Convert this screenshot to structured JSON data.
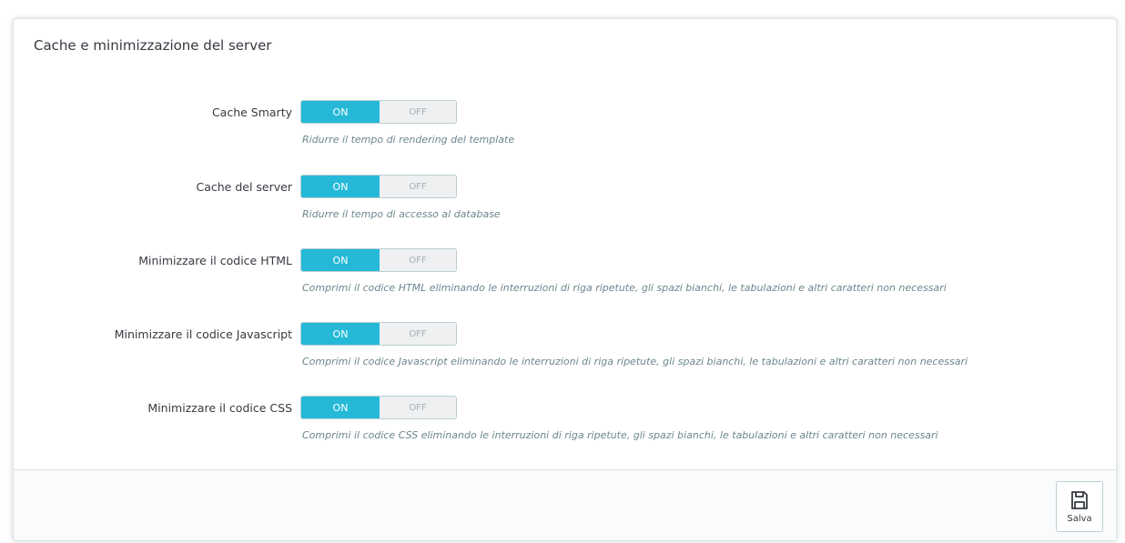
{
  "panel": {
    "title": "Cache e minimizzazione del server"
  },
  "settings": [
    {
      "label": "Cache Smarty",
      "on_label": "ON",
      "off_label": "OFF",
      "value": "ON",
      "help": "Ridurre il tempo di rendering del template"
    },
    {
      "label": "Cache del server",
      "on_label": "ON",
      "off_label": "OFF",
      "value": "ON",
      "help": "Ridurre il tempo di accesso al database"
    },
    {
      "label": "Minimizzare il codice HTML",
      "on_label": "ON",
      "off_label": "OFF",
      "value": "ON",
      "help": "Comprimi il codice HTML eliminando le interruzioni di riga ripetute, gli spazi bianchi, le tabulazioni e altri caratteri non necessari"
    },
    {
      "label": "Minimizzare il codice Javascript",
      "on_label": "ON",
      "off_label": "OFF",
      "value": "ON",
      "help": "Comprimi il codice Javascript eliminando le interruzioni di riga ripetute, gli spazi bianchi, le tabulazioni e altri caratteri non necessari"
    },
    {
      "label": "Minimizzare il codice CSS",
      "on_label": "ON",
      "off_label": "OFF",
      "value": "ON",
      "help": "Comprimi il codice CSS eliminando le interruzioni di riga ripetute, gli spazi bianchi, le tabulazioni e altri caratteri non necessari"
    }
  ],
  "footer": {
    "save_label": "Salva",
    "save_icon": "floppy-disk-icon"
  },
  "colors": {
    "accent": "#25b9d7",
    "border": "#bbcdd2",
    "help_text": "#6c868e"
  }
}
